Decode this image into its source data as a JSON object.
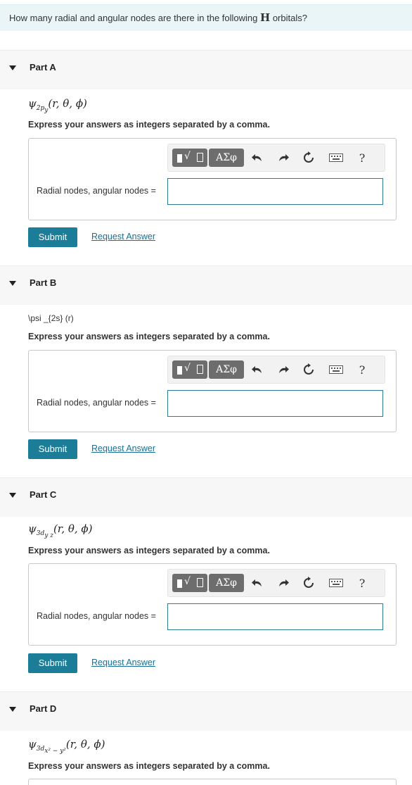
{
  "question": {
    "prefix": "How many radial and angular nodes are there in the following",
    "element": "H",
    "suffix": "orbitals?"
  },
  "parts": [
    {
      "title": "Part A",
      "expression": {
        "psi": "ψ",
        "sub": "2p",
        "subsub": "y",
        "args": "(r, θ, ϕ)"
      },
      "instruction": "Express your answers as integers separated by a comma.",
      "answer_label": "Radial nodes, angular nodes =",
      "answer_value": "",
      "submit_label": "Submit",
      "request_label": "Request Answer"
    },
    {
      "title": "Part B",
      "expression_raw": "\\psi _{2s} (r)",
      "instruction": "Express your answers as integers separated by a comma.",
      "answer_label": "Radial nodes, angular nodes =",
      "answer_value": "",
      "submit_label": "Submit",
      "request_label": "Request Answer"
    },
    {
      "title": "Part C",
      "expression": {
        "psi": "ψ",
        "sub": "3d",
        "subsub": "y z",
        "args": "(r, θ, ϕ)"
      },
      "instruction": "Express your answers as integers separated by a comma.",
      "answer_label": "Radial nodes, angular nodes =",
      "answer_value": "",
      "submit_label": "Submit",
      "request_label": "Request Answer"
    },
    {
      "title": "Part D",
      "expression": {
        "psi": "ψ",
        "sub": "3d",
        "subsub": "x² − y²",
        "args": "(r, θ, ϕ)"
      },
      "instruction": "Express your answers as integers separated by a comma."
    }
  ],
  "toolbar": {
    "greek_label": "ΑΣφ",
    "help_label": "?",
    "icons": [
      "templates-icon",
      "greek-icon",
      "undo-icon",
      "redo-icon",
      "reset-icon",
      "keyboard-icon",
      "help-icon"
    ]
  },
  "colors": {
    "banner_bg": "#e9f5f6",
    "submit_bg": "#1c7d99",
    "link": "#1a6f95",
    "input_border": "#2f7d92"
  }
}
